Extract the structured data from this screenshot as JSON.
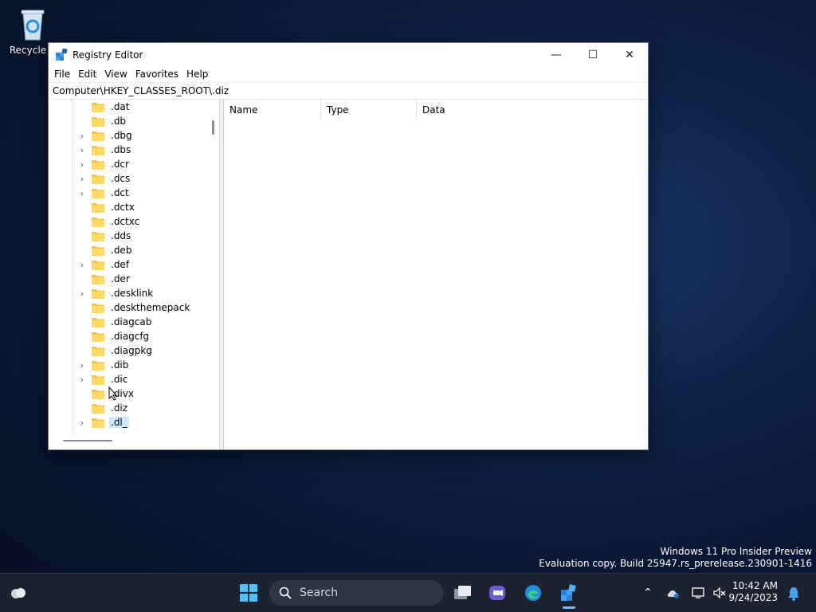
{
  "desktop": {
    "recycle_bin_label": "Recycle B"
  },
  "window": {
    "title": "Registry Editor",
    "minimize": "—",
    "maximize": "☐",
    "close": "✕",
    "menu": [
      "File",
      "Edit",
      "View",
      "Favorites",
      "Help"
    ],
    "address": "Computer\\HKEY_CLASSES_ROOT\\.diz"
  },
  "tree": {
    "items": [
      {
        "label": ".dat",
        "expandable": false
      },
      {
        "label": ".db",
        "expandable": false
      },
      {
        "label": ".dbg",
        "expandable": true
      },
      {
        "label": ".dbs",
        "expandable": true
      },
      {
        "label": ".dcr",
        "expandable": true
      },
      {
        "label": ".dcs",
        "expandable": true
      },
      {
        "label": ".dct",
        "expandable": true
      },
      {
        "label": ".dctx",
        "expandable": false
      },
      {
        "label": ".dctxc",
        "expandable": false
      },
      {
        "label": ".dds",
        "expandable": false
      },
      {
        "label": ".deb",
        "expandable": false
      },
      {
        "label": ".def",
        "expandable": true
      },
      {
        "label": ".der",
        "expandable": false
      },
      {
        "label": ".desklink",
        "expandable": true
      },
      {
        "label": ".deskthemepack",
        "expandable": false
      },
      {
        "label": ".diagcab",
        "expandable": false
      },
      {
        "label": ".diagcfg",
        "expandable": false
      },
      {
        "label": ".diagpkg",
        "expandable": false
      },
      {
        "label": ".dib",
        "expandable": true
      },
      {
        "label": ".dic",
        "expandable": true
      },
      {
        "label": ".divx",
        "expandable": false
      },
      {
        "label": ".diz",
        "expandable": false
      },
      {
        "label": ".dl_",
        "expandable": true,
        "selected": true
      }
    ]
  },
  "list": {
    "columns": [
      "Name",
      "Type",
      "Data"
    ]
  },
  "watermark": {
    "line1": "Windows 11 Pro Insider Preview",
    "line2": "Evaluation copy. Build 25947.rs_prerelease.230901-1416"
  },
  "taskbar": {
    "search_placeholder": "Search",
    "time": "10:42 AM",
    "date": "9/24/2023"
  },
  "colors": {
    "selection": "#cce8ff",
    "folder": "#f4c542",
    "taskbar": "#1c2230"
  }
}
